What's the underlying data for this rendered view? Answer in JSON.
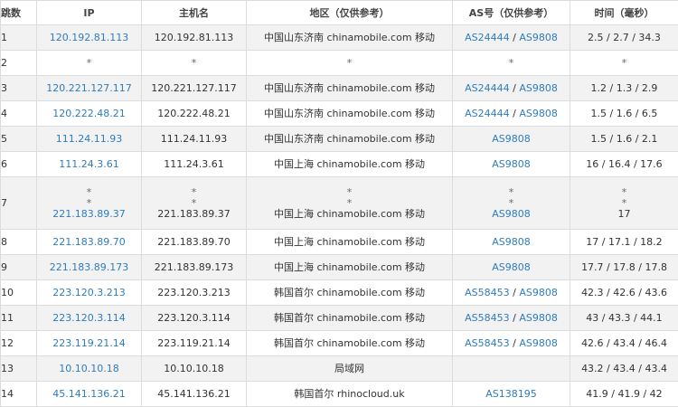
{
  "columns": [
    "跳数",
    "IP",
    "主机名",
    "地区（仅供参考）",
    "AS号（仅供参考）",
    "时间（毫秒）"
  ],
  "hops": [
    {
      "hop": "1",
      "ip": [
        "120.192.81.113"
      ],
      "host": [
        "120.192.81.113"
      ],
      "location": [
        "中国山东济南 chinamobile.com 移动"
      ],
      "as": [
        [
          "AS24444",
          "AS9808"
        ]
      ],
      "time": [
        "2.5 / 2.7 / 34.3"
      ]
    },
    {
      "hop": "2",
      "ip": [
        "*"
      ],
      "host": [
        "*"
      ],
      "location": [
        "*"
      ],
      "as": [
        [
          "*"
        ]
      ],
      "time": [
        "*"
      ]
    },
    {
      "hop": "3",
      "ip": [
        "120.221.127.117"
      ],
      "host": [
        "120.221.127.117"
      ],
      "location": [
        "中国山东济南 chinamobile.com 移动"
      ],
      "as": [
        [
          "AS24444",
          "AS9808"
        ]
      ],
      "time": [
        "1.2 / 1.3 / 2.9"
      ]
    },
    {
      "hop": "4",
      "ip": [
        "120.222.48.21"
      ],
      "host": [
        "120.222.48.21"
      ],
      "location": [
        "中国山东济南 chinamobile.com 移动"
      ],
      "as": [
        [
          "AS24444",
          "AS9808"
        ]
      ],
      "time": [
        "1.5 / 1.6 / 6.5"
      ]
    },
    {
      "hop": "5",
      "ip": [
        "111.24.11.93"
      ],
      "host": [
        "111.24.11.93"
      ],
      "location": [
        "中国山东济南 chinamobile.com 移动"
      ],
      "as": [
        [
          "AS9808"
        ]
      ],
      "time": [
        "1.5 / 1.6 / 2.1"
      ]
    },
    {
      "hop": "6",
      "ip": [
        "111.24.3.61"
      ],
      "host": [
        "111.24.3.61"
      ],
      "location": [
        "中国上海 chinamobile.com 移动"
      ],
      "as": [
        [
          "AS9808"
        ]
      ],
      "time": [
        "16 / 16.4 / 17.6"
      ]
    },
    {
      "hop": "7",
      "ip": [
        "*",
        "*",
        "221.183.89.37"
      ],
      "host": [
        "*",
        "*",
        "221.183.89.37"
      ],
      "location": [
        "*",
        "*",
        "中国上海 chinamobile.com 移动"
      ],
      "as": [
        [
          "*"
        ],
        [
          "*"
        ],
        [
          "AS9808"
        ]
      ],
      "time": [
        "*",
        "*",
        "17"
      ]
    },
    {
      "hop": "8",
      "ip": [
        "221.183.89.70"
      ],
      "host": [
        "221.183.89.70"
      ],
      "location": [
        "中国上海 chinamobile.com 移动"
      ],
      "as": [
        [
          "AS9808"
        ]
      ],
      "time": [
        "17 / 17.1 / 18.2"
      ]
    },
    {
      "hop": "9",
      "ip": [
        "221.183.89.173"
      ],
      "host": [
        "221.183.89.173"
      ],
      "location": [
        "中国上海 chinamobile.com 移动"
      ],
      "as": [
        [
          "AS9808"
        ]
      ],
      "time": [
        "17.7 / 17.8 / 17.8"
      ]
    },
    {
      "hop": "10",
      "ip": [
        "223.120.3.213"
      ],
      "host": [
        "223.120.3.213"
      ],
      "location": [
        "韩国首尔 chinamobile.com 移动"
      ],
      "as": [
        [
          "AS58453",
          "AS9808"
        ]
      ],
      "time": [
        "42.3 / 42.6 / 43.6"
      ]
    },
    {
      "hop": "11",
      "ip": [
        "223.120.3.114"
      ],
      "host": [
        "223.120.3.114"
      ],
      "location": [
        "韩国首尔 chinamobile.com 移动"
      ],
      "as": [
        [
          "AS58453",
          "AS9808"
        ]
      ],
      "time": [
        "43 / 43.3 / 44.1"
      ]
    },
    {
      "hop": "12",
      "ip": [
        "223.119.21.14"
      ],
      "host": [
        "223.119.21.14"
      ],
      "location": [
        "韩国首尔 chinamobile.com 移动"
      ],
      "as": [
        [
          "AS58453",
          "AS9808"
        ]
      ],
      "time": [
        "42.6 / 43.4 / 46.4"
      ]
    },
    {
      "hop": "13",
      "ip": [
        "10.10.10.18"
      ],
      "host": [
        "10.10.10.18"
      ],
      "location": [
        "局域网"
      ],
      "as": [
        []
      ],
      "time": [
        "43.2 / 43.4 / 43.4"
      ]
    },
    {
      "hop": "14",
      "ip": [
        "45.141.136.21"
      ],
      "host": [
        "45.141.136.21"
      ],
      "location": [
        "韩国首尔 rhinocloud.uk"
      ],
      "as": [
        [
          "AS138195"
        ]
      ],
      "time": [
        "41.9 / 41.9 / 42"
      ]
    }
  ],
  "colors": {
    "link": "#2e7cbf",
    "row_alt": "#f2f2f2",
    "border": "#dcdcdc"
  }
}
